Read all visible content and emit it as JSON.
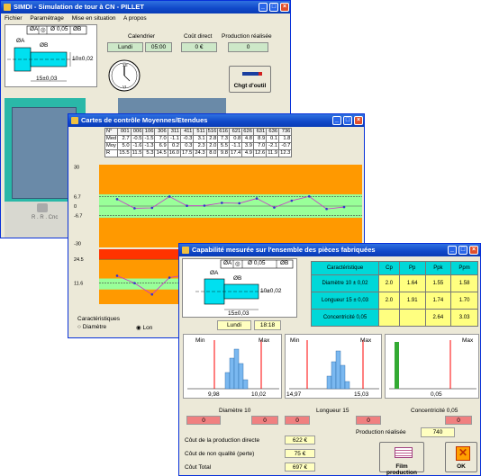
{
  "main_window": {
    "title": "SIMDI - Simulation de tour à CN - PILLET",
    "menu": [
      "Fichier",
      "Paramétrage",
      "Mise en situation",
      "A propos"
    ],
    "calendrier_label": "Calendrier",
    "day": "Lundi",
    "time": "05:00",
    "cout_direct_label": "Coût direct",
    "cout_direct_value": "0 €",
    "production_realisee_label": "Production réalisée",
    "production_realisee_value": "0",
    "chgt_outil_label": "Chgt d'outil",
    "drawing": {
      "datum_a": "ØA",
      "datum_b": "ØB",
      "tolerance_frame": [
        "ØA",
        "◎",
        "Ø 0,05",
        "ØB"
      ],
      "dim_diameter": "10±0,02",
      "dim_length": "15±0,03"
    },
    "side_fragment": "R . R . Cnc"
  },
  "control_window": {
    "title": "Cartes de contrôle Moyennes/Etendues",
    "grid": {
      "headers": [
        "N°",
        "001",
        "006",
        "106",
        "306",
        "311",
        "411",
        "511",
        "516",
        "616",
        "621",
        "626",
        "631",
        "636",
        "736"
      ],
      "rows": [
        {
          "label": "Med",
          "values": [
            "2.7",
            "-0.5",
            "-1.5",
            "7.0",
            "-1.1",
            "-0.3",
            "3.1",
            "2.8",
            "7.3",
            "0.8",
            "4.8",
            "8.9",
            "0.1",
            "1.8"
          ]
        },
        {
          "label": "Moy",
          "values": [
            "5.0",
            "-1.6",
            "-1.3",
            "6.9",
            "0.2",
            "0.3",
            "2.3",
            "2.0",
            "5.5",
            "-1.1",
            "3.9",
            "7.0",
            "-2.1",
            "-0.7"
          ]
        },
        {
          "label": "R",
          "values": [
            "15.5",
            "11.5",
            "5.3",
            "14.5",
            "16.0",
            "17.5",
            "24.3",
            "8.0",
            "9.8",
            "17.4",
            "4.9",
            "12.6",
            "11.9",
            "12.3"
          ]
        }
      ]
    },
    "axis_labels": [
      "30",
      "6.7",
      "0",
      "-6.7",
      "-30",
      "24.5",
      "11.6"
    ],
    "caracteristiques_label": "Caractéristiques",
    "radio_diametre": "Diamètre",
    "radio_longueur": "Lon",
    "colors": {
      "orange": "#ff9900",
      "red": "#ff3300",
      "green": "#99ff99",
      "mean_line": "#cc33cc",
      "points": "#3333cc"
    }
  },
  "chart_data": {
    "type": "line",
    "title": "",
    "series": [
      {
        "name": "Moy",
        "x": [
          1,
          2,
          3,
          4,
          5,
          6,
          7,
          8,
          9,
          10,
          11,
          12,
          13,
          14
        ],
        "values": [
          5.0,
          -1.6,
          -1.3,
          6.9,
          0.2,
          0.3,
          2.3,
          2.0,
          5.5,
          -1.1,
          3.9,
          7.0,
          -2.1,
          -0.7
        ]
      },
      {
        "name": "R",
        "x": [
          1,
          2,
          3,
          4,
          5,
          6,
          7,
          8,
          9,
          10,
          11,
          12,
          13,
          14
        ],
        "values": [
          15.5,
          11.5,
          5.3,
          14.5,
          16.0,
          17.5,
          24.3,
          8.0,
          9.8,
          17.4,
          4.9,
          12.6,
          11.9,
          12.3
        ]
      }
    ],
    "mean_chart": {
      "ylim": [
        -30,
        30
      ],
      "control_limits": [
        6.7,
        -6.7
      ],
      "center": 0
    },
    "range_chart": {
      "control_limit": 24.5,
      "center": 11.6
    }
  },
  "capability_window": {
    "title": "Capabilité mesurée sur l'ensemble des pièces fabriquées",
    "table": {
      "headers": [
        "Caractéristique",
        "Cp",
        "Pp",
        "Ppk",
        "Ppm"
      ],
      "rows": [
        {
          "name": "Diamètre 10 ± 0,02",
          "cp": "2.0",
          "pp": "1.64",
          "ppk": "1.55",
          "ppm": "1.58"
        },
        {
          "name": "Longueur 15 ± 0,03",
          "cp": "2.0",
          "pp": "1.91",
          "ppk": "1.74",
          "ppm": "1.70"
        },
        {
          "name": "Concentricité 0,05",
          "cp": "",
          "pp": "",
          "ppk": "2.64",
          "ppm": "3.03"
        }
      ]
    },
    "day": "Lundi",
    "time": "18:18",
    "histograms": [
      {
        "min_label": "Min",
        "max_label": "Max",
        "low": "9,98",
        "high": "10,02",
        "title": "Diamètre 10",
        "left_count": "0",
        "right_count": "0"
      },
      {
        "min_label": "Min",
        "max_label": "Max",
        "low": "14,97",
        "high": "15,03",
        "title": "Longueur 15",
        "left_count": "0",
        "right_count": "0"
      },
      {
        "min_label": "",
        "max_label": "Max",
        "low": "",
        "high": "0,05",
        "title": "Concentricité 0,05",
        "left_count": "",
        "right_count": "0"
      }
    ],
    "production_realisee_label": "Production réalisée",
    "production_realisee_value": "740",
    "costs": [
      {
        "label": "Côut de la production directe",
        "value": "622 €"
      },
      {
        "label": "Côut de non qualité (perte)",
        "value": "75 €"
      },
      {
        "label": "Côut Total",
        "value": "697 €"
      }
    ],
    "film_button": "Film production",
    "ok_button": "OK"
  }
}
